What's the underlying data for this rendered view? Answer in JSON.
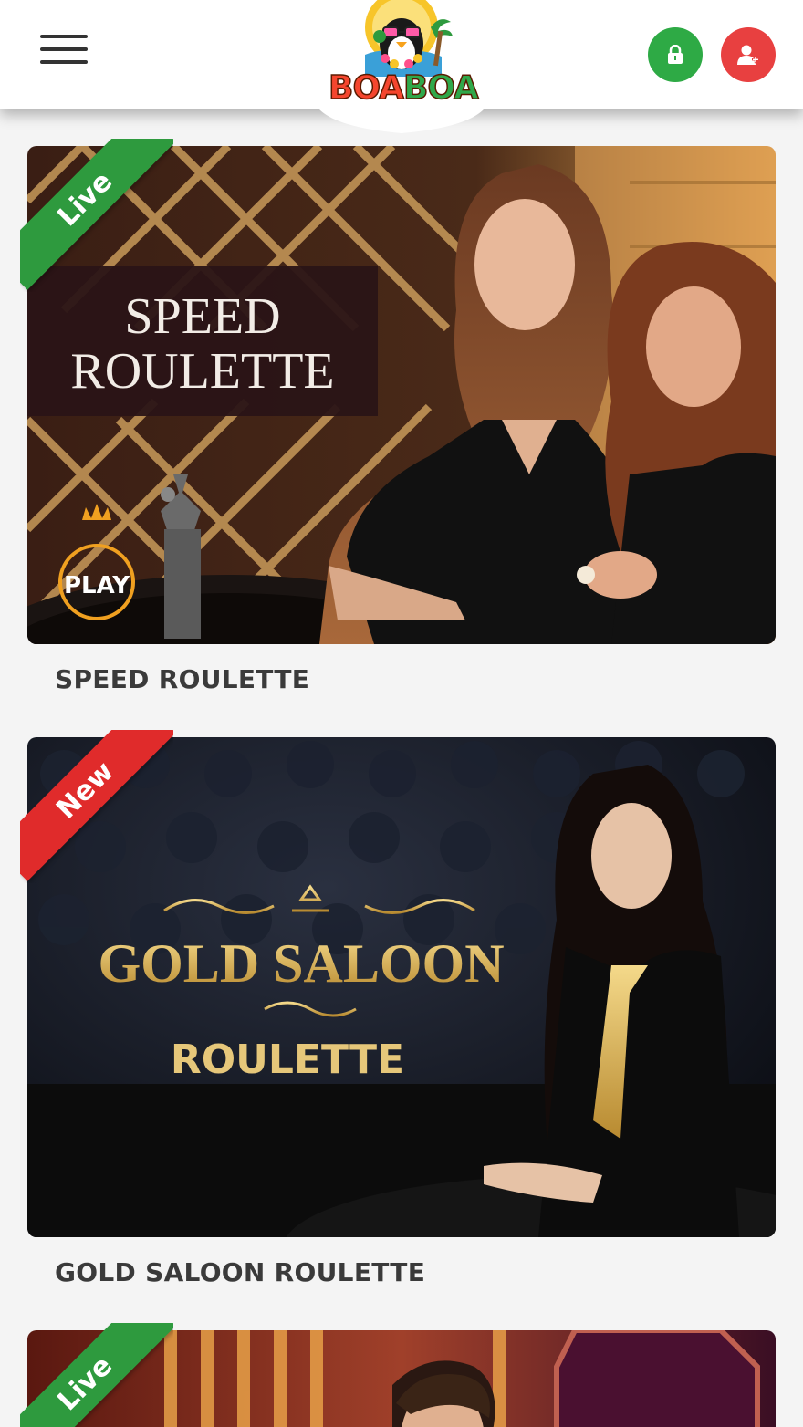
{
  "header": {
    "logo": {
      "text_part1": "BOA",
      "text_part2": "BOA",
      "mascot_icon": "penguin-mascot"
    },
    "login_icon": "lock-icon",
    "register_icon": "add-user-icon",
    "menu_icon": "hamburger-menu-icon"
  },
  "colors": {
    "live_ribbon": "#2e9a3e",
    "new_ribbon": "#e02b2b",
    "login_button": "#2eaa45",
    "register_button": "#e84040"
  },
  "games": [
    {
      "badge": "Live",
      "image_title_line1": "SPEED",
      "image_title_line2": "ROULETTE",
      "provider_badge": "PLAY",
      "title": "SPEED ROULETTE"
    },
    {
      "badge": "New",
      "image_title_line1": "GOLD SALOON",
      "image_title_line2": "ROULETTE",
      "title": "GOLD SALOON ROULETTE"
    },
    {
      "badge": "Live"
    }
  ]
}
